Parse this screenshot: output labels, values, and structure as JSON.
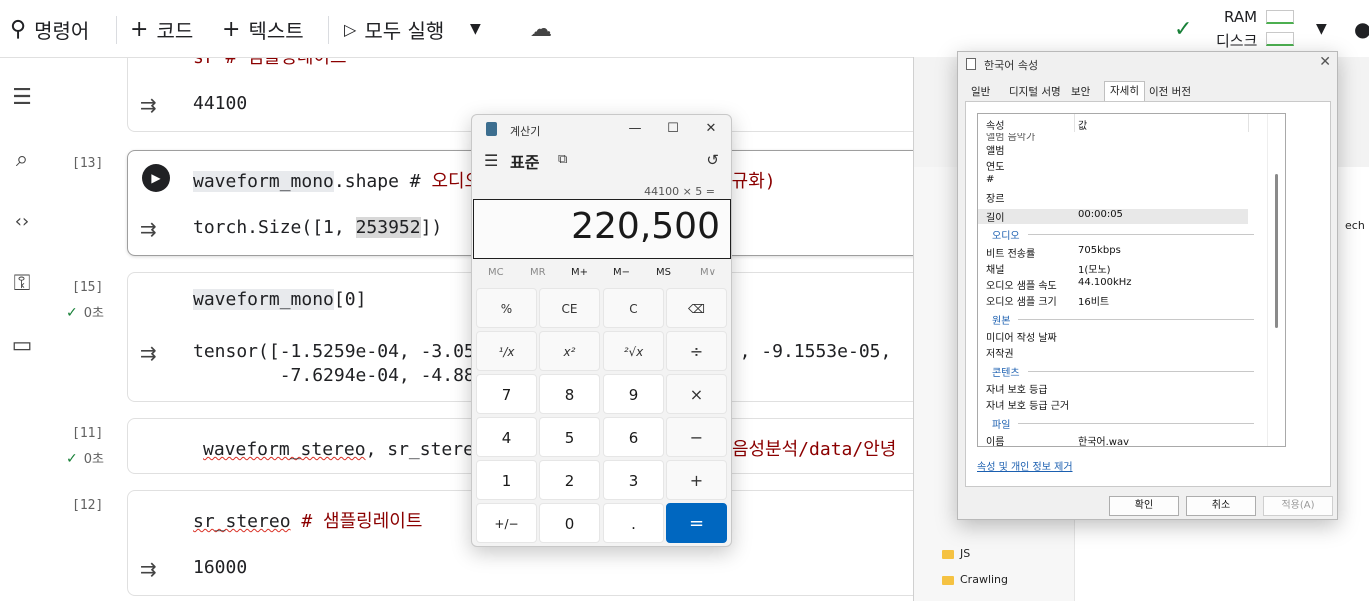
{
  "toolbar": {
    "command": "명령어",
    "code": "코드",
    "text": "텍스트",
    "run_all": "모두 실행",
    "ram": "RAM",
    "disk": "디스크"
  },
  "cells": {
    "c0": {
      "partial_code": "sr # 샘플링레이트",
      "output": "44100"
    },
    "c13": {
      "exec": "[13]",
      "code_var": "waveform_mono",
      "code_rest": ".shape # ",
      "code_cm_a": "오디오",
      "code_cm_b": "이로 정규화)",
      "out_a": "torch.Size([1, ",
      "out_hl": "253952",
      "out_b": "])"
    },
    "c15": {
      "exec": "[15]",
      "time": "0초",
      "code_var": "waveform_mono",
      "code_rest": "[0]",
      "out_line1a": "tensor([-1.5259e-04, -3.051",
      "out_line1b": ", -9.1553e-05,",
      "out_line2": "        -7.6294e-04, -4.882"
    },
    "c11": {
      "exec": "[11]",
      "time": "0초",
      "code_var": "waveform_stereo",
      "code_rest": ", sr_stere",
      "code_cm": "음성분석/data/안녕"
    },
    "c12": {
      "exec": "[12]",
      "code_var": "sr_stereo",
      "code_cm": " # 샘플링레이트",
      "output": "16000"
    }
  },
  "explorer": {
    "visible_items": [
      "JS",
      "Crawling"
    ],
    "partial_text": "ech"
  },
  "calculator": {
    "title": "계산기",
    "mode": "표준",
    "expression": "44100 × 5 =",
    "result": "220,500",
    "memory": [
      "MC",
      "MR",
      "M+",
      "M−",
      "MS",
      "M∨"
    ],
    "keys": [
      [
        "%",
        "CE",
        "C",
        "⌫"
      ],
      [
        "¹/x",
        "x²",
        "²√x",
        "÷"
      ],
      [
        "7",
        "8",
        "9",
        "×"
      ],
      [
        "4",
        "5",
        "6",
        "−"
      ],
      [
        "1",
        "2",
        "3",
        "+"
      ],
      [
        "+/−",
        "0",
        ".",
        "="
      ]
    ]
  },
  "properties": {
    "title": "한국어 속성",
    "tabs": [
      "일반",
      "디지털 서명",
      "보안",
      "자세히",
      "이전 버전"
    ],
    "selected_tab": "자세히",
    "col_property": "속성",
    "col_value": "값",
    "rows": [
      {
        "name": "앨범",
        "value": ""
      },
      {
        "name": "연도",
        "value": ""
      },
      {
        "name": "#",
        "value": ""
      },
      {
        "name": "장르",
        "value": ""
      },
      {
        "name": "길이",
        "value": "00:00:05"
      }
    ],
    "sec_audio": "오디오",
    "audio_rows": [
      {
        "name": "비트 전송률",
        "value": "705kbps"
      },
      {
        "name": "채널",
        "value": "1(모노)"
      },
      {
        "name": "오디오 샘플 속도",
        "value": "44.100kHz"
      },
      {
        "name": "오디오 샘플 크기",
        "value": "16비트"
      }
    ],
    "sec_origin": "원본",
    "origin_rows": [
      {
        "name": "미디어 작성 날짜",
        "value": ""
      },
      {
        "name": "저작권",
        "value": ""
      }
    ],
    "sec_content": "콘텐츠",
    "content_rows": [
      {
        "name": "자녀 보호 등급",
        "value": ""
      },
      {
        "name": "자녀 보호 등급 근거",
        "value": ""
      }
    ],
    "sec_file": "파일",
    "file_rows": [
      {
        "name": "이름",
        "value": "한국어.wav"
      }
    ],
    "remove_link": "속성 및 개인 정보 제거",
    "ok": "확인",
    "cancel": "취소",
    "apply": "적용(A)"
  }
}
